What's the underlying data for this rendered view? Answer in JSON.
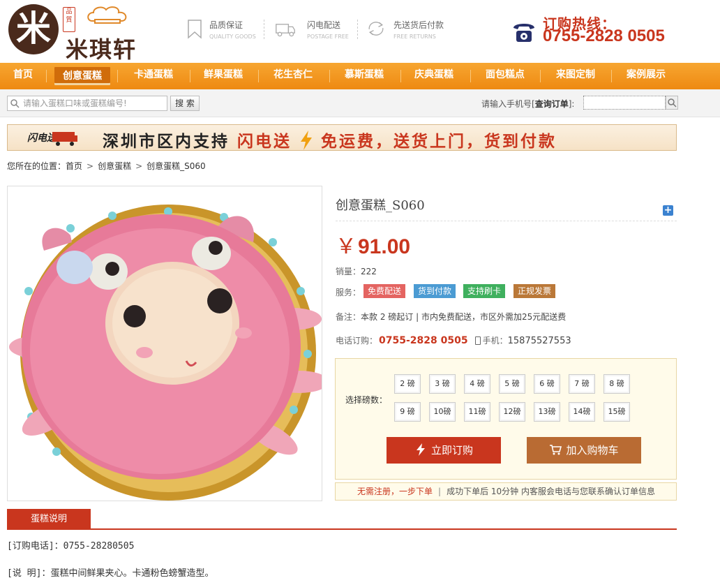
{
  "brand": {
    "seal_text": "品質",
    "name": "米琪轩",
    "colors": {
      "primary": "#c9361e",
      "nav": "#f29a1f",
      "brown": "#4a2a1c"
    }
  },
  "header": {
    "features": [
      {
        "icon": "bookmark-icon",
        "title": "品质保证",
        "subtitle": "QUALITY GOODS"
      },
      {
        "icon": "truck-icon",
        "title": "闪电配送",
        "subtitle": "POSTAGE FREE"
      },
      {
        "icon": "return-icon",
        "title": "先送货后付款",
        "subtitle": "FREE RETURNS"
      }
    ],
    "hotline_title": "订购热线：",
    "hotline_number": "0755-2828 0505"
  },
  "nav": {
    "items": [
      "首页",
      "创意蛋糕",
      "卡通蛋糕",
      "鲜果蛋糕",
      "花生杏仁",
      "慕斯蛋糕",
      "庆典蛋糕",
      "面包糕点",
      "来图定制",
      "案例展示"
    ],
    "active": "创意蛋糕"
  },
  "search": {
    "placeholder": "请输入蛋糕口味或蛋糕编号!",
    "button": "搜 索",
    "order_label_prefix": "请输入手机号[",
    "order_label_bold": "查询订单",
    "order_label_suffix": "]:"
  },
  "banner": {
    "badge": "闪电送",
    "text_black_1": "深圳市区内支持",
    "text_red_1": "闪电送",
    "text_red_2": "免运费，送货上门，货到付款"
  },
  "breadcrumb": {
    "label": "您所在的位置：",
    "items": [
      "首页",
      "创意蛋糕",
      "创意蛋糕_S060"
    ]
  },
  "product": {
    "title": "创意蛋糕_S060",
    "currency": "￥",
    "price": "91.00",
    "sales_label": "销量：",
    "sales_value": "222",
    "service_label": "服务：",
    "services": [
      "免费配送",
      "货到付款",
      "支持刷卡",
      "正规发票"
    ],
    "note_label": "备注：",
    "note_text": "本款 2 磅起订 | 市内免费配送，市区外需加25元配送费",
    "phone_label": "电话订购：",
    "phone_value": "0755-2828 0505",
    "mobile_label": "手机：",
    "mobile_value": "15875527553"
  },
  "order": {
    "weight_label": "选择磅数：",
    "weights": [
      "2 磅",
      "3 磅",
      "4 磅",
      "5 磅",
      "6 磅",
      "7 磅",
      "8 磅",
      "9 磅",
      "10磅",
      "11磅",
      "12磅",
      "13磅",
      "14磅",
      "15磅"
    ],
    "buy_label": "立即订购",
    "cart_label": "加入购物车",
    "note_highlight": "无需注册，一步下单",
    "note_sep": "|",
    "note_text": "成功下单后 10分钟 内客服会电话与您联系确认订单信息"
  },
  "tabs": {
    "active": "蛋糕说明"
  },
  "description": {
    "phone_line": "[订购电话]：0755-28280505",
    "desc_line": "[说 明]：蛋糕中间鲜果夹心。卡通粉色螃蟹造型。"
  }
}
